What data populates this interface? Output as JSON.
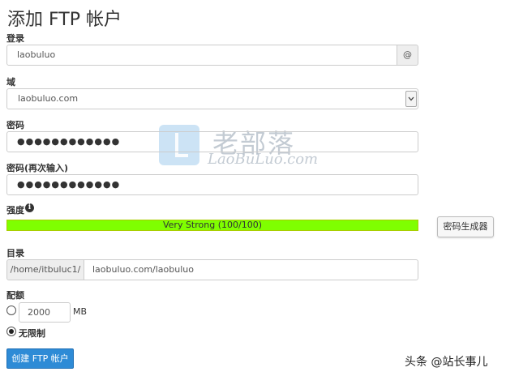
{
  "page_title": "添加 FTP 帐户",
  "login": {
    "label": "登录",
    "value": "laobuluo",
    "at_symbol": "@"
  },
  "domain": {
    "label": "域",
    "value": "laobuluo.com"
  },
  "password": {
    "label": "密码",
    "value": "●●●●●●●●●●●●"
  },
  "password_confirm": {
    "label": "密码(再次输入)",
    "value": "●●●●●●●●●●●●"
  },
  "strength": {
    "label": "强度",
    "info_icon": "info-icon",
    "text": "Very Strong (100/100)",
    "percent": 100,
    "color": "#7fff00"
  },
  "generator_button": "密码生成器",
  "directory": {
    "label": "目录",
    "prefix": "/home/itbuluc1/",
    "value": "laobuluo.com/laobuluo"
  },
  "quota": {
    "label": "配额",
    "value": "2000",
    "unit": "MB",
    "unlimited_label": "无限制",
    "selected": "unlimited"
  },
  "submit_button": "创建 FTP 帐户",
  "watermark": {
    "cn": "老部落",
    "en": "LaoBuLuo.com"
  },
  "corner_credit": "头条 @站长事儿",
  "colors": {
    "primary": "#2e8bd6",
    "strength_bar": "#7fff00"
  }
}
